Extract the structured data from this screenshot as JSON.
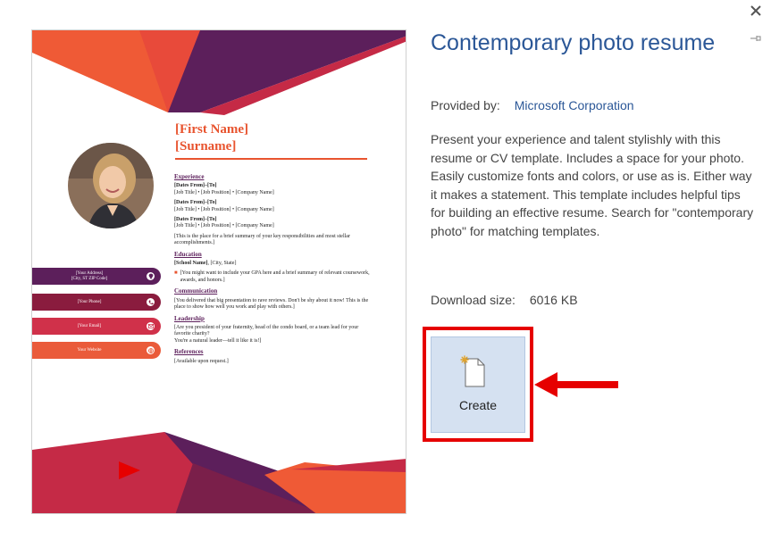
{
  "dialog": {
    "close_icon": "close-icon",
    "pin_icon": "pin-icon"
  },
  "template": {
    "title": "Contemporary photo resume",
    "provided_by_label": "Provided by:",
    "provider": "Microsoft Corporation",
    "description": "Present your experience and talent stylishly with this resume or CV template.  Includes a space for your photo.  Easily customize fonts and colors, or use as is.  Either way it makes a statement. This template includes helpful tips for building an effective resume. Search for \"contemporary photo\" for matching templates.",
    "download_label": "Download size:",
    "download_size": "6016 KB",
    "create_label": "Create"
  },
  "preview": {
    "first_name": "[First Name]",
    "surname": "[Surname]",
    "experience_heading": "Experience",
    "jobs": [
      {
        "dates": "[Dates From]–[To]",
        "line": "[Job Title] • [Job Position] • [Company Name]"
      },
      {
        "dates": "[Dates From]–[To]",
        "line": "[Job Title] • [Job Position] • [Company Name]"
      },
      {
        "dates": "[Dates From]–[To]",
        "line": "[Job Title] • [Job Position] • [Company Name]"
      }
    ],
    "experience_summary": "[This is the place for a brief summary of your key responsibilities and most stellar accomplishments.]",
    "education_heading": "Education",
    "school": "[School Name]",
    "school_location": ", [City, State]",
    "education_note": "[You might want to include your GPA here and a brief summary of relevant coursework, awards, and honors.]",
    "communication_heading": "Communication",
    "communication_text": "[You delivered that big presentation to rave reviews.  Don't be shy about it now!  This is the place to show how well you work and play with others.]",
    "leadership_heading": "Leadership",
    "leadership_text_1": "[Are you president of your fraternity, head of the condo board, or a team lead for your favorite charity?",
    "leadership_text_2": "You're a natural leader—tell it like it is!]",
    "references_heading": "References",
    "references_text": "[Available upon request.]",
    "contacts": [
      {
        "label_1": "[Your Address]",
        "label_2": "[City, ST  ZIP Code]",
        "icon": "location-pin-icon",
        "color": "#5c1f5b"
      },
      {
        "label_1": "[Your Phone]",
        "label_2": "",
        "icon": "phone-icon",
        "color": "#8a1c3e"
      },
      {
        "label_1": "[Your Email]",
        "label_2": "",
        "icon": "email-icon",
        "color": "#d0314a"
      },
      {
        "label_1": "Your Website",
        "label_2": "",
        "icon": "globe-icon",
        "color": "#ea5b3a"
      }
    ],
    "colors": {
      "orange": "#ef5a36",
      "plum": "#5c1f5b",
      "crimson": "#c52a46",
      "accent_red": "#e60000"
    }
  }
}
